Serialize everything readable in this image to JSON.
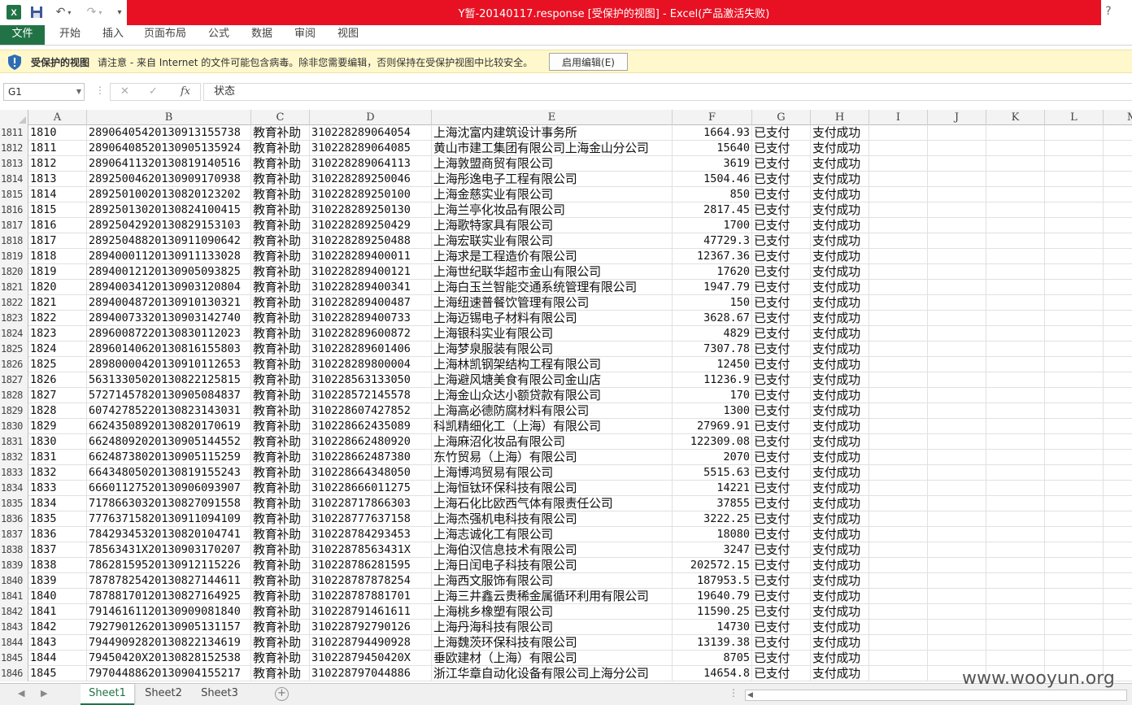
{
  "window": {
    "title": "Y暂-20140117.response  [受保护的视图] -  Excel(产品激活失败)",
    "help": "?"
  },
  "ribbon": {
    "tabs": [
      "文件",
      "开始",
      "插入",
      "页面布局",
      "公式",
      "数据",
      "审阅",
      "视图"
    ]
  },
  "protected_view": {
    "title": "受保护的视图",
    "message": "请注意 - 来自 Internet 的文件可能包含病毒。除非您需要编辑，否则保持在受保护视图中比较安全。",
    "button": "启用编辑(E)"
  },
  "formula_bar": {
    "name_box": "G1",
    "fx": "fx",
    "content": "状态"
  },
  "columns": [
    "A",
    "B",
    "C",
    "D",
    "E",
    "F",
    "G",
    "H",
    "I",
    "J",
    "K",
    "L",
    "M"
  ],
  "rows": [
    {
      "n": "1811",
      "a": "1810",
      "b": "28906405420130913155738",
      "c": "教育补助",
      "d": "310228289064054",
      "e": "上海沈富内建筑设计事务所",
      "f": "1664.93",
      "g": "已支付",
      "h": "支付成功"
    },
    {
      "n": "1812",
      "a": "1811",
      "b": "28906408520130905135924",
      "c": "教育补助",
      "d": "310228289064085",
      "e": "黄山市建工集团有限公司上海金山分公司",
      "f": "15640",
      "g": "已支付",
      "h": "支付成功"
    },
    {
      "n": "1813",
      "a": "1812",
      "b": "28906411320130819140516",
      "c": "教育补助",
      "d": "310228289064113",
      "e": "上海敦盟商贸有限公司",
      "f": "3619",
      "g": "已支付",
      "h": "支付成功"
    },
    {
      "n": "1814",
      "a": "1813",
      "b": "28925004620130909170938",
      "c": "教育补助",
      "d": "310228289250046",
      "e": "上海彤逸电子工程有限公司",
      "f": "1504.46",
      "g": "已支付",
      "h": "支付成功"
    },
    {
      "n": "1815",
      "a": "1814",
      "b": "28925010020130820123202",
      "c": "教育补助",
      "d": "310228289250100",
      "e": "上海金慈实业有限公司",
      "f": "850",
      "g": "已支付",
      "h": "支付成功"
    },
    {
      "n": "1816",
      "a": "1815",
      "b": "28925013020130824100415",
      "c": "教育补助",
      "d": "310228289250130",
      "e": "上海兰亭化妆品有限公司",
      "f": "2817.45",
      "g": "已支付",
      "h": "支付成功"
    },
    {
      "n": "1817",
      "a": "1816",
      "b": "28925042920130829153103",
      "c": "教育补助",
      "d": "310228289250429",
      "e": "上海歌特家具有限公司",
      "f": "1700",
      "g": "已支付",
      "h": "支付成功"
    },
    {
      "n": "1818",
      "a": "1817",
      "b": "28925048820130911090642",
      "c": "教育补助",
      "d": "310228289250488",
      "e": "上海宏联实业有限公司",
      "f": "47729.3",
      "g": "已支付",
      "h": "支付成功"
    },
    {
      "n": "1819",
      "a": "1818",
      "b": "28940001120130911133028",
      "c": "教育补助",
      "d": "310228289400011",
      "e": "上海求是工程造价有限公司",
      "f": "12367.36",
      "g": "已支付",
      "h": "支付成功"
    },
    {
      "n": "1820",
      "a": "1819",
      "b": "28940012120130905093825",
      "c": "教育补助",
      "d": "310228289400121",
      "e": "上海世纪联华超市金山有限公司",
      "f": "17620",
      "g": "已支付",
      "h": "支付成功"
    },
    {
      "n": "1821",
      "a": "1820",
      "b": "28940034120130903120804",
      "c": "教育补助",
      "d": "310228289400341",
      "e": "上海白玉兰智能交通系统管理有限公司",
      "f": "1947.79",
      "g": "已支付",
      "h": "支付成功"
    },
    {
      "n": "1822",
      "a": "1821",
      "b": "28940048720130910130321",
      "c": "教育补助",
      "d": "310228289400487",
      "e": "上海纽速普餐饮管理有限公司",
      "f": "150",
      "g": "已支付",
      "h": "支付成功"
    },
    {
      "n": "1823",
      "a": "1822",
      "b": "28940073320130903142740",
      "c": "教育补助",
      "d": "310228289400733",
      "e": "上海迈锡电子材料有限公司",
      "f": "3628.67",
      "g": "已支付",
      "h": "支付成功"
    },
    {
      "n": "1824",
      "a": "1823",
      "b": "28960087220130830112023",
      "c": "教育补助",
      "d": "310228289600872",
      "e": "上海银科实业有限公司",
      "f": "4829",
      "g": "已支付",
      "h": "支付成功"
    },
    {
      "n": "1825",
      "a": "1824",
      "b": "28960140620130816155803",
      "c": "教育补助",
      "d": "310228289601406",
      "e": "上海梦泉服装有限公司",
      "f": "7307.78",
      "g": "已支付",
      "h": "支付成功"
    },
    {
      "n": "1826",
      "a": "1825",
      "b": "28980000420130910112653",
      "c": "教育补助",
      "d": "310228289800004",
      "e": "上海林凯钢架结构工程有限公司",
      "f": "12450",
      "g": "已支付",
      "h": "支付成功"
    },
    {
      "n": "1827",
      "a": "1826",
      "b": "56313305020130822125815",
      "c": "教育补助",
      "d": "310228563133050",
      "e": "上海避风塘美食有限公司金山店",
      "f": "11236.9",
      "g": "已支付",
      "h": "支付成功"
    },
    {
      "n": "1828",
      "a": "1827",
      "b": "57271457820130905084837",
      "c": "教育补助",
      "d": "310228572145578",
      "e": "上海金山众达小额贷款有限公司",
      "f": "170",
      "g": "已支付",
      "h": "支付成功"
    },
    {
      "n": "1829",
      "a": "1828",
      "b": "60742785220130823143031",
      "c": "教育补助",
      "d": "310228607427852",
      "e": "上海高必德防腐材料有限公司",
      "f": "1300",
      "g": "已支付",
      "h": "支付成功"
    },
    {
      "n": "1830",
      "a": "1829",
      "b": "66243508920130820170619",
      "c": "教育补助",
      "d": "310228662435089",
      "e": "科凯精细化工（上海）有限公司",
      "f": "27969.91",
      "g": "已支付",
      "h": "支付成功"
    },
    {
      "n": "1831",
      "a": "1830",
      "b": "66248092020130905144552",
      "c": "教育补助",
      "d": "310228662480920",
      "e": "上海麻沼化妆品有限公司",
      "f": "122309.08",
      "g": "已支付",
      "h": "支付成功"
    },
    {
      "n": "1832",
      "a": "1831",
      "b": "66248738020130905115259",
      "c": "教育补助",
      "d": "310228662487380",
      "e": "东竹贸易（上海）有限公司",
      "f": "2070",
      "g": "已支付",
      "h": "支付成功"
    },
    {
      "n": "1833",
      "a": "1832",
      "b": "66434805020130819155243",
      "c": "教育补助",
      "d": "310228664348050",
      "e": "上海博鸿贸易有限公司",
      "f": "5515.63",
      "g": "已支付",
      "h": "支付成功"
    },
    {
      "n": "1834",
      "a": "1833",
      "b": "66601127520130906093907",
      "c": "教育补助",
      "d": "310228666011275",
      "e": "上海恒钛环保科技有限公司",
      "f": "14221",
      "g": "已支付",
      "h": "支付成功"
    },
    {
      "n": "1835",
      "a": "1834",
      "b": "71786630320130827091558",
      "c": "教育补助",
      "d": "310228717866303",
      "e": "上海石化比欧西气体有限责任公司",
      "f": "37855",
      "g": "已支付",
      "h": "支付成功"
    },
    {
      "n": "1836",
      "a": "1835",
      "b": "77763715820130911094109",
      "c": "教育补助",
      "d": "310228777637158",
      "e": "上海杰强机电科技有限公司",
      "f": "3222.25",
      "g": "已支付",
      "h": "支付成功"
    },
    {
      "n": "1837",
      "a": "1836",
      "b": "78429345320130820104741",
      "c": "教育补助",
      "d": "310228784293453",
      "e": "上海志诚化工有限公司",
      "f": "18080",
      "g": "已支付",
      "h": "支付成功"
    },
    {
      "n": "1838",
      "a": "1837",
      "b": "78563431X20130903170207",
      "c": "教育补助",
      "d": "31022878563431X",
      "e": "上海伯汉信息技术有限公司",
      "f": "3247",
      "g": "已支付",
      "h": "支付成功"
    },
    {
      "n": "1839",
      "a": "1838",
      "b": "78628159520130912115226",
      "c": "教育补助",
      "d": "310228786281595",
      "e": "上海日闰电子科技有限公司",
      "f": "202572.15",
      "g": "已支付",
      "h": "支付成功"
    },
    {
      "n": "1840",
      "a": "1839",
      "b": "78787825420130827144611",
      "c": "教育补助",
      "d": "310228787878254",
      "e": "上海西文服饰有限公司",
      "f": "187953.5",
      "g": "已支付",
      "h": "支付成功"
    },
    {
      "n": "1841",
      "a": "1840",
      "b": "78788170120130827164925",
      "c": "教育补助",
      "d": "310228787881701",
      "e": "上海三井鑫云贵稀金属循环利用有限公司",
      "f": "19640.79",
      "g": "已支付",
      "h": "支付成功"
    },
    {
      "n": "1842",
      "a": "1841",
      "b": "79146161120130909081840",
      "c": "教育补助",
      "d": "310228791461611",
      "e": "上海桃乡橡塑有限公司",
      "f": "11590.25",
      "g": "已支付",
      "h": "支付成功"
    },
    {
      "n": "1843",
      "a": "1842",
      "b": "79279012620130905131157",
      "c": "教育补助",
      "d": "310228792790126",
      "e": "上海丹海科技有限公司",
      "f": "14730",
      "g": "已支付",
      "h": "支付成功"
    },
    {
      "n": "1844",
      "a": "1843",
      "b": "79449092820130822134619",
      "c": "教育补助",
      "d": "310228794490928",
      "e": "上海魏茨环保科技有限公司",
      "f": "13139.38",
      "g": "已支付",
      "h": "支付成功"
    },
    {
      "n": "1845",
      "a": "1844",
      "b": "79450420X20130828152538",
      "c": "教育补助",
      "d": "31022879450420X",
      "e": "垂欧建材（上海）有限公司",
      "f": "8705",
      "g": "已支付",
      "h": "支付成功"
    },
    {
      "n": "1846",
      "a": "1845",
      "b": "79704488620130904155217",
      "c": "教育补助",
      "d": "310228797044886",
      "e": "浙江华章自动化设备有限公司上海分公司",
      "f": "14654.8",
      "g": "已支付",
      "h": "支付成功"
    }
  ],
  "sheets": [
    "Sheet1",
    "Sheet2",
    "Sheet3"
  ],
  "watermark": "www.wooyun.org",
  "colors": {
    "accent": "#217346",
    "titlebar": "#e81123",
    "protected_bar": "#fff8cc"
  }
}
